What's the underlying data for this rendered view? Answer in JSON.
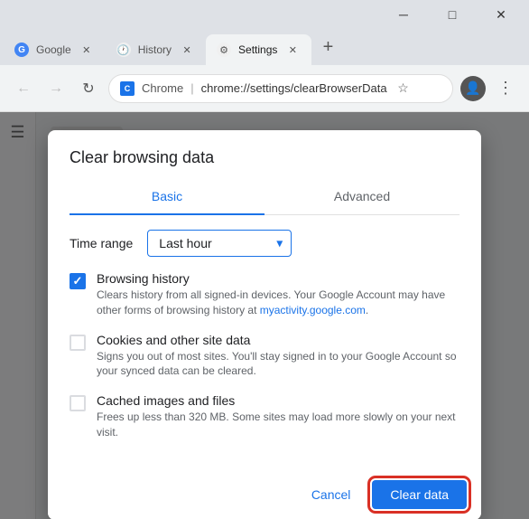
{
  "titlebar": {
    "minimize_label": "─",
    "maximize_label": "□",
    "close_label": "✕"
  },
  "tabs": [
    {
      "id": "google",
      "label": "Google",
      "favicon_color": "#4285F4",
      "favicon_letter": "G",
      "active": false
    },
    {
      "id": "history",
      "label": "History",
      "favicon_color": "#666",
      "favicon_letter": "🕐",
      "active": false
    },
    {
      "id": "settings",
      "label": "Settings",
      "favicon_color": "#666",
      "favicon_letter": "⚙",
      "active": true
    }
  ],
  "new_tab_label": "+",
  "addressbar": {
    "back_icon": "←",
    "forward_icon": "→",
    "refresh_icon": "↻",
    "brand_name": "Chrome",
    "url_display": "chrome://settings/clearBrowserData",
    "star_icon": "☆",
    "menu_icon": "⋮"
  },
  "dialog": {
    "title": "Clear browsing data",
    "tab_basic": "Basic",
    "tab_advanced": "Advanced",
    "time_range_label": "Time range",
    "time_range_value": "Last hour",
    "options": [
      {
        "id": "browsing-history",
        "title": "Browsing history",
        "description": "Clears history from all signed-in devices. Your Google Account may have other forms of browsing history at ",
        "link_text": "myactivity.google.com",
        "link_after": ".",
        "checked": true
      },
      {
        "id": "cookies",
        "title": "Cookies and other site data",
        "description": "Signs you out of most sites. You'll stay signed in to your Google Account so your synced data can be cleared.",
        "link_text": "",
        "link_after": "",
        "checked": false
      },
      {
        "id": "cached",
        "title": "Cached images and files",
        "description": "Frees up less than 320 MB. Some sites may load more slowly on your next visit.",
        "link_text": "",
        "link_after": "",
        "checked": false
      }
    ],
    "cancel_label": "Cancel",
    "clear_label": "Clear data"
  }
}
